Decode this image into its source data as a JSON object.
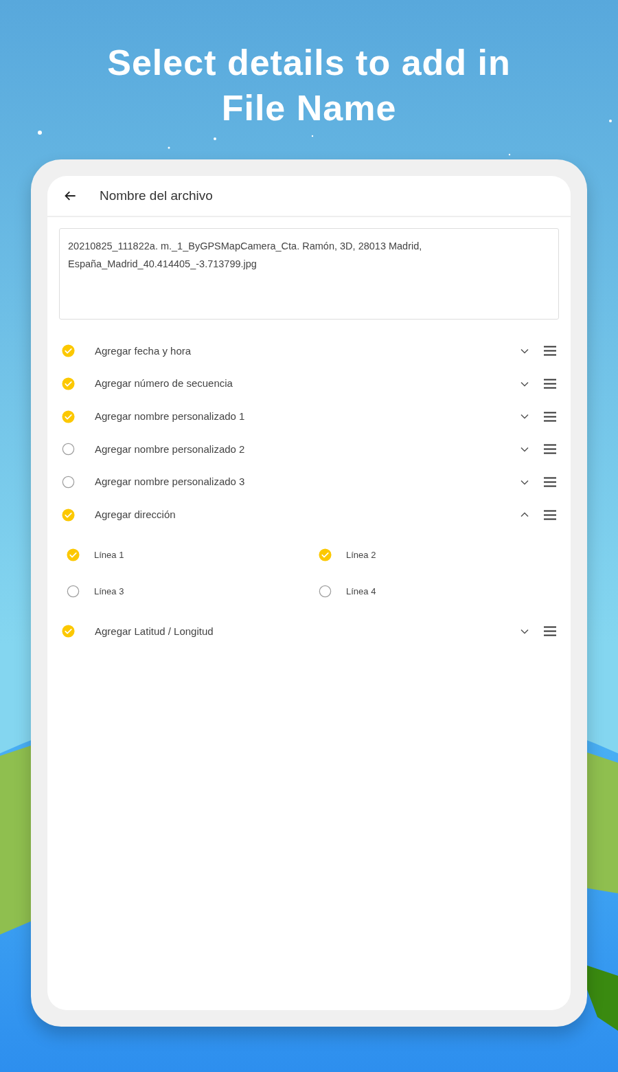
{
  "headline": "Select details to add in File Name",
  "screen": {
    "title": "Nombre del archivo",
    "filename_field": {
      "value": "20210825_111822a. m._1_ByGPSMapCamera_Cta. Ramón, 3D, 28013 Madrid, España_Madrid_40.414405_-3.713799.jpg"
    },
    "options": [
      {
        "label": "Agregar fecha y hora",
        "checked": true,
        "expanded": false
      },
      {
        "label": "Agregar número de secuencia",
        "checked": true,
        "expanded": false
      },
      {
        "label": "Agregar nombre personalizado 1",
        "checked": true,
        "expanded": false
      },
      {
        "label": "Agregar nombre personalizado 2",
        "checked": false,
        "expanded": false
      },
      {
        "label": "Agregar nombre personalizado 3",
        "checked": false,
        "expanded": false
      },
      {
        "label": "Agregar dirección",
        "checked": true,
        "expanded": true,
        "sub_options": [
          {
            "label": "Línea 1",
            "checked": true
          },
          {
            "label": "Línea 2",
            "checked": true
          },
          {
            "label": "Línea 3",
            "checked": false
          },
          {
            "label": "Línea 4",
            "checked": false
          }
        ]
      },
      {
        "label": "Agregar Latitud / Longitud",
        "checked": true,
        "expanded": false
      }
    ]
  }
}
